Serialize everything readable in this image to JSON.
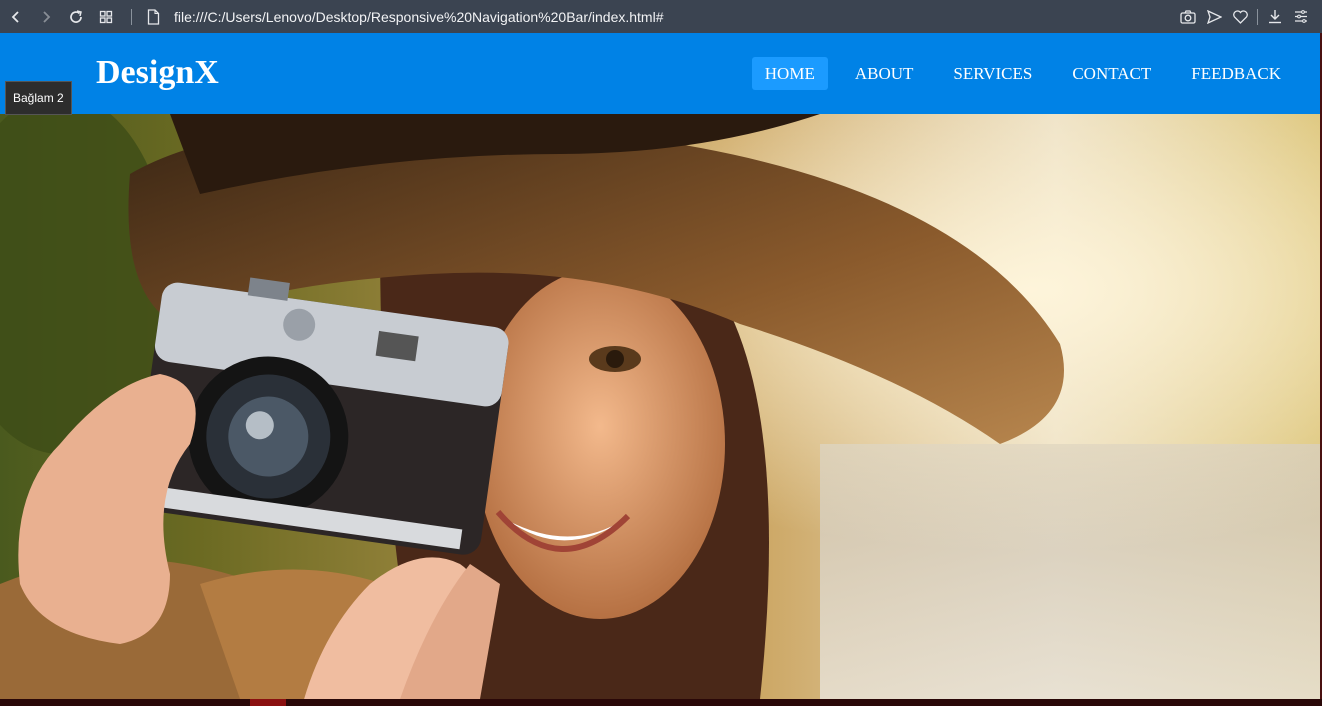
{
  "browser": {
    "url": "file:///C:/Users/Lenovo/Desktop/Responsive%20Navigation%20Bar/index.html#",
    "icons": [
      "back-icon",
      "forward-icon",
      "reload-icon",
      "tabs-grid-icon",
      "page-icon",
      "camera-icon",
      "send-icon",
      "heart-icon",
      "download-icon",
      "menu-lines-icon"
    ]
  },
  "navbar": {
    "logo": "DesignX",
    "links": [
      {
        "label": "HOME",
        "active": true
      },
      {
        "label": "ABOUT",
        "active": false
      },
      {
        "label": "SERVICES",
        "active": false
      },
      {
        "label": "CONTACT",
        "active": false
      },
      {
        "label": "FEEDBACK",
        "active": false
      }
    ],
    "background_color": "#0082e6",
    "active_color": "#1b9bff"
  },
  "tooltip": {
    "text": "Bağlam 2"
  },
  "hero": {
    "image_subject": "woman-with-hat-holding-camera"
  }
}
